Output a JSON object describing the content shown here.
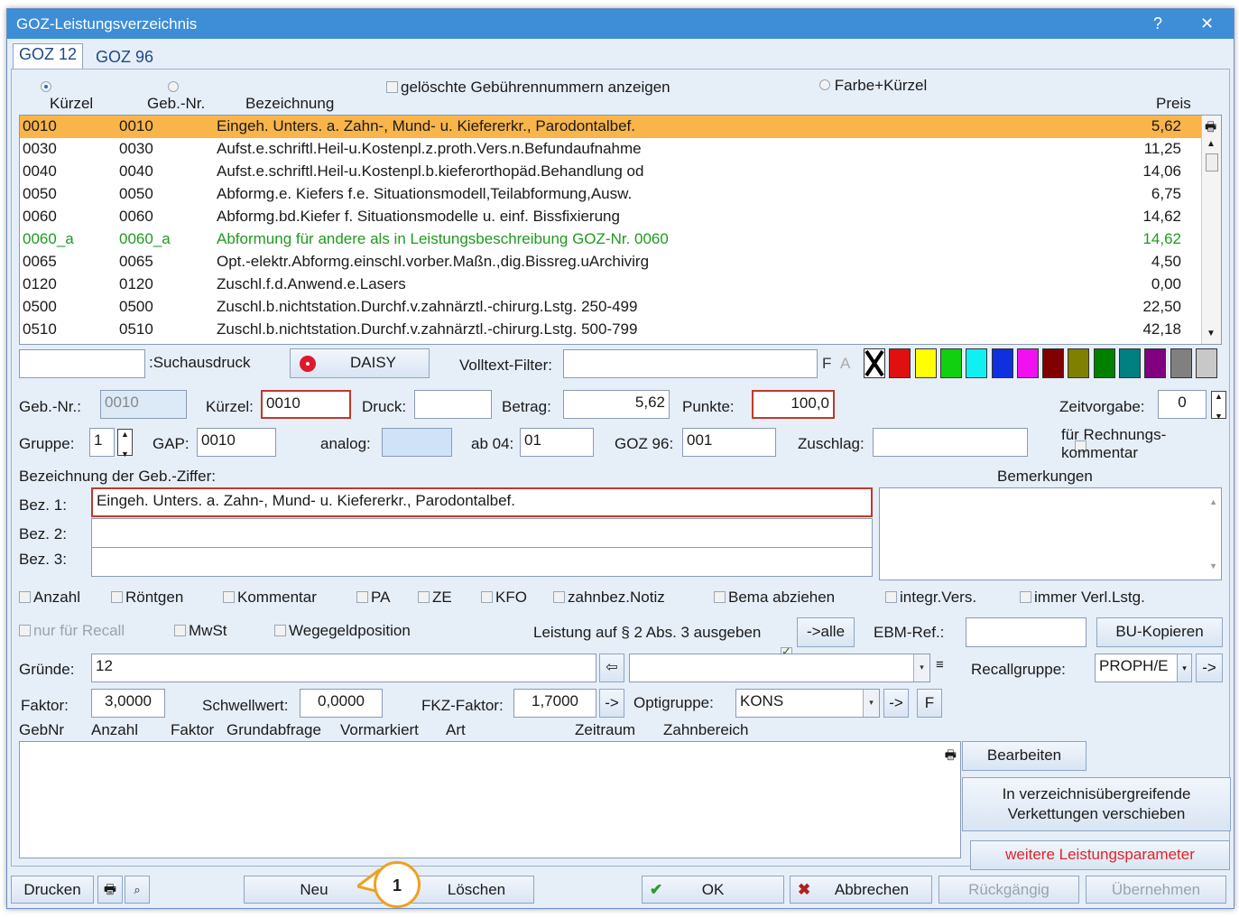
{
  "window": {
    "title": "GOZ-Leistungsverzeichnis",
    "help": "?",
    "close": "✕"
  },
  "tabs": [
    "GOZ 12",
    "GOZ 96"
  ],
  "list_header": {
    "kuerzel": "Kürzel",
    "gebnr": "Geb.-Nr.",
    "bezeichnung": "Bezeichnung",
    "preis": "Preis",
    "show_deleted": "gelöschte Gebührennummern anzeigen",
    "farbe": "Farbe+Kürzel"
  },
  "rows": [
    {
      "k": "0010",
      "g": "0010",
      "b": "Eingeh. Unters. a. Zahn-, Mund- u. Kiefererkr., Parodontalbef.",
      "p": "5,62"
    },
    {
      "k": "0030",
      "g": "0030",
      "b": "Aufst.e.schriftl.Heil-u.Kostenpl.z.proth.Vers.n.Befundaufnahme",
      "p": "11,25"
    },
    {
      "k": "0040",
      "g": "0040",
      "b": "Aufst.e.schriftl.Heil-u.Kostenpl.b.kieferorthopäd.Behandlung od",
      "p": "14,06"
    },
    {
      "k": "0050",
      "g": "0050",
      "b": "Abformg.e. Kiefers  f.e. Situationsmodell,Teilabformung,Ausw.",
      "p": "6,75"
    },
    {
      "k": "0060",
      "g": "0060",
      "b": "Abformg.bd.Kiefer f. Situationsmodelle u. einf. Bissfixierung",
      "p": "14,62"
    },
    {
      "k": "0060_a",
      "g": "0060_a",
      "b": "Abformung für andere als in Leistungsbeschreibung GOZ-Nr. 0060",
      "p": "14,62"
    },
    {
      "k": "0065",
      "g": "0065",
      "b": "Opt.-elektr.Abformg.einschl.vorber.Maßn.,dig.Bissreg.uArchivirg",
      "p": "4,50"
    },
    {
      "k": "0120",
      "g": "0120",
      "b": "Zuschl.f.d.Anwend.e.Lasers",
      "p": "0,00"
    },
    {
      "k": "0500",
      "g": "0500",
      "b": "Zuschl.b.nichtstation.Durchf.v.zahnärztl.-chirurg.Lstg. 250-499",
      "p": "22,50"
    },
    {
      "k": "0510",
      "g": "0510",
      "b": "Zuschl.b.nichtstation.Durchf.v.zahnärztl.-chirurg.Lstg. 500-799",
      "p": "42,18"
    }
  ],
  "search": {
    "label": ":Suchausdruck",
    "daisy": "DAISY",
    "volltext": "Volltext-Filter:",
    "f": "F",
    "a": "A"
  },
  "colors": [
    "#ffffff",
    "#e01010",
    "#ffff00",
    "#10d010",
    "#10f0f0",
    "#1030e0",
    "#f010f0",
    "#800000",
    "#808000",
    "#008000",
    "#008080",
    "#800080",
    "#808080",
    "#c8c8c8"
  ],
  "fields": {
    "gebnr_l": "Geb.-Nr.:",
    "gebnr": "0010",
    "kuerzel_l": "Kürzel:",
    "kuerzel": "0010",
    "druck_l": "Druck:",
    "druck": "",
    "betrag_l": "Betrag:",
    "betrag": "5,62",
    "punkte_l": "Punkte:",
    "punkte": "100,0",
    "zeit_l": "Zeitvorgabe:",
    "zeit": "0",
    "gruppe_l": "Gruppe:",
    "gruppe": "1",
    "gap_l": "GAP:",
    "gap": "0010",
    "analog_l": "analog:",
    "ab04_l": "ab 04:",
    "ab04": "01",
    "goz96_l": "GOZ 96:",
    "goz96": "001",
    "zuschlag_l": "Zuschlag:",
    "rechnung_l": "für Rechnungs-kommentar",
    "bezgeb_l": "Bezeichnung der Geb.-Ziffer:",
    "bemerk_l": "Bemerkungen",
    "bez1_l": "Bez. 1:",
    "bez1": "Eingeh. Unters. a. Zahn-, Mund- u. Kiefererkr., Parodontalbef.",
    "bez2_l": "Bez. 2:",
    "bez3_l": "Bez. 3:"
  },
  "checks1": [
    "Anzahl",
    "Röntgen",
    "Kommentar",
    "PA",
    "ZE",
    "KFO",
    "zahnbez.Notiz",
    "Bema abziehen",
    "integr.Vers.",
    "immer Verl.Lstg."
  ],
  "checks2": {
    "recall": "nur für Recall",
    "mwst": "MwSt",
    "wege": "Wegegeldposition",
    "leistung": "Leistung auf § 2 Abs. 3 ausgeben",
    "alle": "->alle",
    "ebm": "EBM-Ref.:",
    "bu": "BU-Kopieren"
  },
  "gruende": {
    "label": "Gründe:",
    "value": "12",
    "recall_l": "Recallgruppe:",
    "recall": "PROPH/E",
    "arrow": "->"
  },
  "faktor": {
    "label": "Faktor:",
    "value": "3,0000",
    "schwell_l": "Schwellwert:",
    "schwell": "0,0000",
    "fkz_l": "FKZ-Faktor:",
    "fkz": "1,7000",
    "arrow": "->",
    "opti_l": "Optigruppe:",
    "opti": "KONS",
    "f": "F"
  },
  "subheader": [
    "GebNr",
    "Anzahl",
    "Faktor",
    "Grundabfrage",
    "Vormarkiert",
    "Art",
    "Zeitraum",
    "Zahnbereich"
  ],
  "side": {
    "bearbeiten": "Bearbeiten",
    "verketten": "In verzeichnisübergreifende Verkettungen verschieben",
    "weitere": "weitere Leistungsparameter"
  },
  "bottom": {
    "drucken": "Drucken",
    "neu": "Neu",
    "loeschen": "Löschen",
    "ok": "OK",
    "abbrechen": "Abbrechen",
    "rueck": "Rückgängig",
    "uebern": "Übernehmen"
  },
  "callout": "1"
}
